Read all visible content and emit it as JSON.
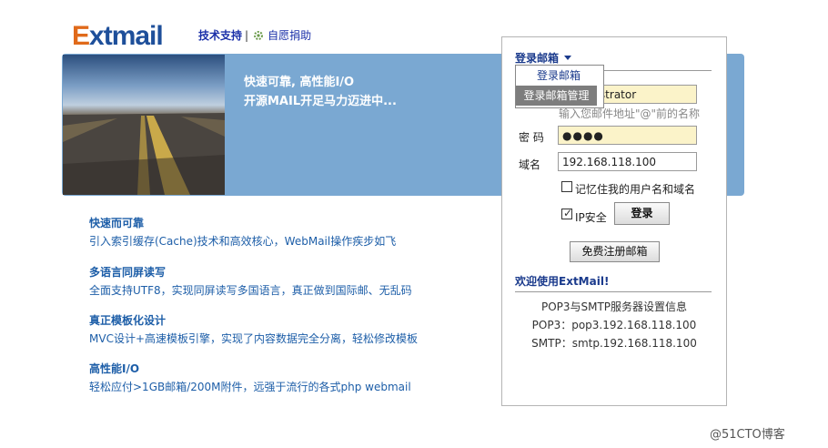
{
  "logo": {
    "first": "E",
    "rest": "xtmail"
  },
  "top_links": {
    "support": "技术支持",
    "separator": "|",
    "donate": "自愿捐助"
  },
  "banner": {
    "line1": "快速可靠, 高性能I/O",
    "line2": "开源MAIL开足马力迈进中..."
  },
  "features": [
    {
      "title": "快速而可靠",
      "desc": "引入索引缓存(Cache)技术和高效核心，WebMail操作疾步如飞"
    },
    {
      "title": "多语言同屏读写",
      "desc": "全面支持UTF8，实现同屏读写多国语言，真正做到国际邮、无乱码"
    },
    {
      "title": "真正模板化设计",
      "desc": "MVC设计+高速模板引擎，实现了内容数据完全分离，轻松修改模板"
    },
    {
      "title": "高性能I/O",
      "desc": "轻松应付>1GB邮箱/200M附件，远强于流行的各式php webmail"
    }
  ],
  "login": {
    "mailbox_select": "登录邮箱",
    "dropdown": [
      "登录邮箱",
      "登录邮箱管理"
    ],
    "username_label": "",
    "username_value": "administrator",
    "username_hint": "输入您邮件地址\"@\"前的名称",
    "password_label": "密 码",
    "password_value": "●●●●",
    "domain_label": "域名",
    "domain_value": "192.168.118.100",
    "remember_label": "记忆住我的用户名和域名",
    "ip_safe_label": "IP安全",
    "ip_safe_checked": true,
    "remember_checked": false,
    "login_button": "登录",
    "register_button": "免费注册邮箱"
  },
  "info": {
    "welcome": "欢迎使用ExtMail!",
    "server_title": "POP3与SMTP服务器设置信息",
    "pop3": "POP3：pop3.192.168.118.100",
    "smtp": "SMTP：smtp.192.168.118.100"
  },
  "watermark": "@51CTO博客",
  "colors": {
    "banner": "#7aa8d2",
    "link": "#1d5ea8",
    "field_yellow": "#fbf3c9",
    "logo_orange": "#e06a1a",
    "logo_blue": "#1e4f9a"
  }
}
